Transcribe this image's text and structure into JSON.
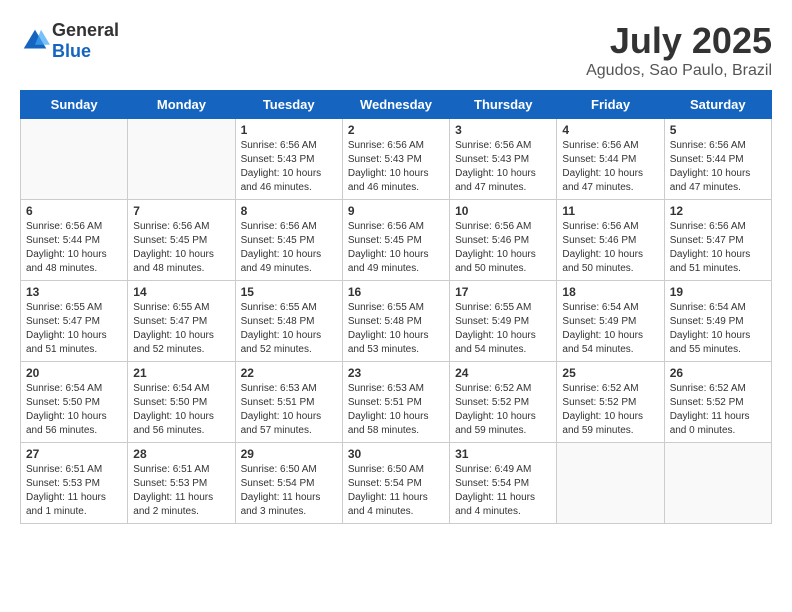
{
  "header": {
    "logo": {
      "general": "General",
      "blue": "Blue"
    },
    "title": "July 2025",
    "location": "Agudos, Sao Paulo, Brazil"
  },
  "days_of_week": [
    "Sunday",
    "Monday",
    "Tuesday",
    "Wednesday",
    "Thursday",
    "Friday",
    "Saturday"
  ],
  "weeks": [
    [
      {
        "day": null
      },
      {
        "day": null
      },
      {
        "day": 1,
        "sunrise": "Sunrise: 6:56 AM",
        "sunset": "Sunset: 5:43 PM",
        "daylight": "Daylight: 10 hours and 46 minutes."
      },
      {
        "day": 2,
        "sunrise": "Sunrise: 6:56 AM",
        "sunset": "Sunset: 5:43 PM",
        "daylight": "Daylight: 10 hours and 46 minutes."
      },
      {
        "day": 3,
        "sunrise": "Sunrise: 6:56 AM",
        "sunset": "Sunset: 5:43 PM",
        "daylight": "Daylight: 10 hours and 47 minutes."
      },
      {
        "day": 4,
        "sunrise": "Sunrise: 6:56 AM",
        "sunset": "Sunset: 5:44 PM",
        "daylight": "Daylight: 10 hours and 47 minutes."
      },
      {
        "day": 5,
        "sunrise": "Sunrise: 6:56 AM",
        "sunset": "Sunset: 5:44 PM",
        "daylight": "Daylight: 10 hours and 47 minutes."
      }
    ],
    [
      {
        "day": 6,
        "sunrise": "Sunrise: 6:56 AM",
        "sunset": "Sunset: 5:44 PM",
        "daylight": "Daylight: 10 hours and 48 minutes."
      },
      {
        "day": 7,
        "sunrise": "Sunrise: 6:56 AM",
        "sunset": "Sunset: 5:45 PM",
        "daylight": "Daylight: 10 hours and 48 minutes."
      },
      {
        "day": 8,
        "sunrise": "Sunrise: 6:56 AM",
        "sunset": "Sunset: 5:45 PM",
        "daylight": "Daylight: 10 hours and 49 minutes."
      },
      {
        "day": 9,
        "sunrise": "Sunrise: 6:56 AM",
        "sunset": "Sunset: 5:45 PM",
        "daylight": "Daylight: 10 hours and 49 minutes."
      },
      {
        "day": 10,
        "sunrise": "Sunrise: 6:56 AM",
        "sunset": "Sunset: 5:46 PM",
        "daylight": "Daylight: 10 hours and 50 minutes."
      },
      {
        "day": 11,
        "sunrise": "Sunrise: 6:56 AM",
        "sunset": "Sunset: 5:46 PM",
        "daylight": "Daylight: 10 hours and 50 minutes."
      },
      {
        "day": 12,
        "sunrise": "Sunrise: 6:56 AM",
        "sunset": "Sunset: 5:47 PM",
        "daylight": "Daylight: 10 hours and 51 minutes."
      }
    ],
    [
      {
        "day": 13,
        "sunrise": "Sunrise: 6:55 AM",
        "sunset": "Sunset: 5:47 PM",
        "daylight": "Daylight: 10 hours and 51 minutes."
      },
      {
        "day": 14,
        "sunrise": "Sunrise: 6:55 AM",
        "sunset": "Sunset: 5:47 PM",
        "daylight": "Daylight: 10 hours and 52 minutes."
      },
      {
        "day": 15,
        "sunrise": "Sunrise: 6:55 AM",
        "sunset": "Sunset: 5:48 PM",
        "daylight": "Daylight: 10 hours and 52 minutes."
      },
      {
        "day": 16,
        "sunrise": "Sunrise: 6:55 AM",
        "sunset": "Sunset: 5:48 PM",
        "daylight": "Daylight: 10 hours and 53 minutes."
      },
      {
        "day": 17,
        "sunrise": "Sunrise: 6:55 AM",
        "sunset": "Sunset: 5:49 PM",
        "daylight": "Daylight: 10 hours and 54 minutes."
      },
      {
        "day": 18,
        "sunrise": "Sunrise: 6:54 AM",
        "sunset": "Sunset: 5:49 PM",
        "daylight": "Daylight: 10 hours and 54 minutes."
      },
      {
        "day": 19,
        "sunrise": "Sunrise: 6:54 AM",
        "sunset": "Sunset: 5:49 PM",
        "daylight": "Daylight: 10 hours and 55 minutes."
      }
    ],
    [
      {
        "day": 20,
        "sunrise": "Sunrise: 6:54 AM",
        "sunset": "Sunset: 5:50 PM",
        "daylight": "Daylight: 10 hours and 56 minutes."
      },
      {
        "day": 21,
        "sunrise": "Sunrise: 6:54 AM",
        "sunset": "Sunset: 5:50 PM",
        "daylight": "Daylight: 10 hours and 56 minutes."
      },
      {
        "day": 22,
        "sunrise": "Sunrise: 6:53 AM",
        "sunset": "Sunset: 5:51 PM",
        "daylight": "Daylight: 10 hours and 57 minutes."
      },
      {
        "day": 23,
        "sunrise": "Sunrise: 6:53 AM",
        "sunset": "Sunset: 5:51 PM",
        "daylight": "Daylight: 10 hours and 58 minutes."
      },
      {
        "day": 24,
        "sunrise": "Sunrise: 6:52 AM",
        "sunset": "Sunset: 5:52 PM",
        "daylight": "Daylight: 10 hours and 59 minutes."
      },
      {
        "day": 25,
        "sunrise": "Sunrise: 6:52 AM",
        "sunset": "Sunset: 5:52 PM",
        "daylight": "Daylight: 10 hours and 59 minutes."
      },
      {
        "day": 26,
        "sunrise": "Sunrise: 6:52 AM",
        "sunset": "Sunset: 5:52 PM",
        "daylight": "Daylight: 11 hours and 0 minutes."
      }
    ],
    [
      {
        "day": 27,
        "sunrise": "Sunrise: 6:51 AM",
        "sunset": "Sunset: 5:53 PM",
        "daylight": "Daylight: 11 hours and 1 minute."
      },
      {
        "day": 28,
        "sunrise": "Sunrise: 6:51 AM",
        "sunset": "Sunset: 5:53 PM",
        "daylight": "Daylight: 11 hours and 2 minutes."
      },
      {
        "day": 29,
        "sunrise": "Sunrise: 6:50 AM",
        "sunset": "Sunset: 5:54 PM",
        "daylight": "Daylight: 11 hours and 3 minutes."
      },
      {
        "day": 30,
        "sunrise": "Sunrise: 6:50 AM",
        "sunset": "Sunset: 5:54 PM",
        "daylight": "Daylight: 11 hours and 4 minutes."
      },
      {
        "day": 31,
        "sunrise": "Sunrise: 6:49 AM",
        "sunset": "Sunset: 5:54 PM",
        "daylight": "Daylight: 11 hours and 4 minutes."
      },
      {
        "day": null
      },
      {
        "day": null
      }
    ]
  ]
}
